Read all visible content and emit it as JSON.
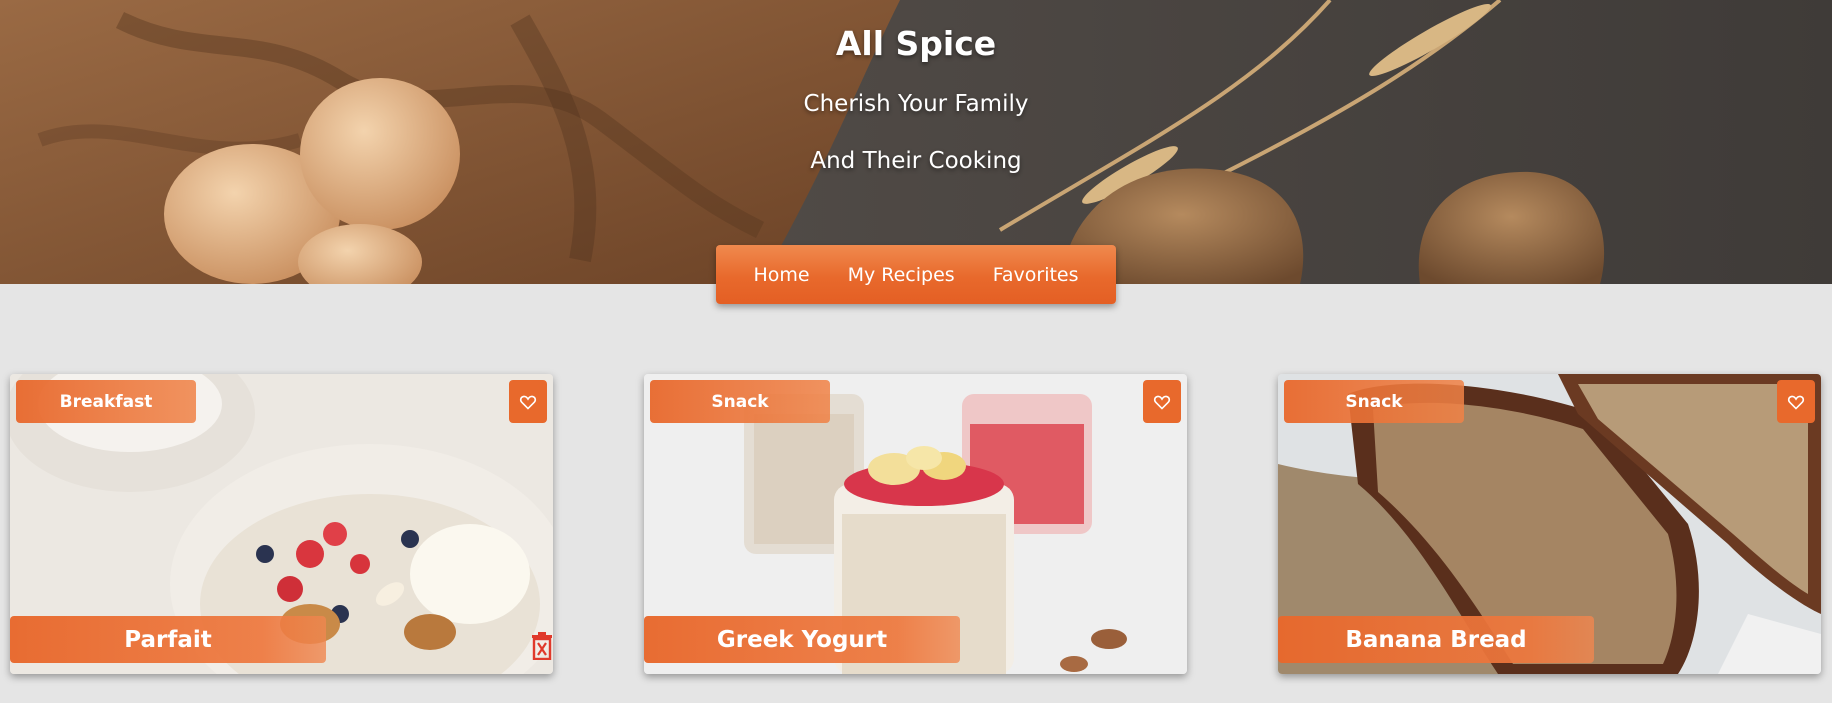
{
  "header": {
    "title": "All Spice",
    "subtitle_line1": "Cherish Your Family",
    "subtitle_line2": "And Their Cooking"
  },
  "nav": {
    "items": [
      {
        "label": "Home"
      },
      {
        "label": "My Recipes"
      },
      {
        "label": "Favorites"
      }
    ]
  },
  "recipes": [
    {
      "category": "Breakfast",
      "title": "Parfait",
      "favorite_icon": "heart-outline-icon",
      "can_delete": true
    },
    {
      "category": "Snack",
      "title": "Greek Yogurt",
      "favorite_icon": "heart-outline-icon",
      "can_delete": false
    },
    {
      "category": "Snack",
      "title": "Banana Bread",
      "favorite_icon": "heart-outline-icon",
      "can_delete": false
    }
  ],
  "colors": {
    "accent": "#e8692c",
    "background": "#e5e5e5",
    "delete": "#e0392b"
  }
}
